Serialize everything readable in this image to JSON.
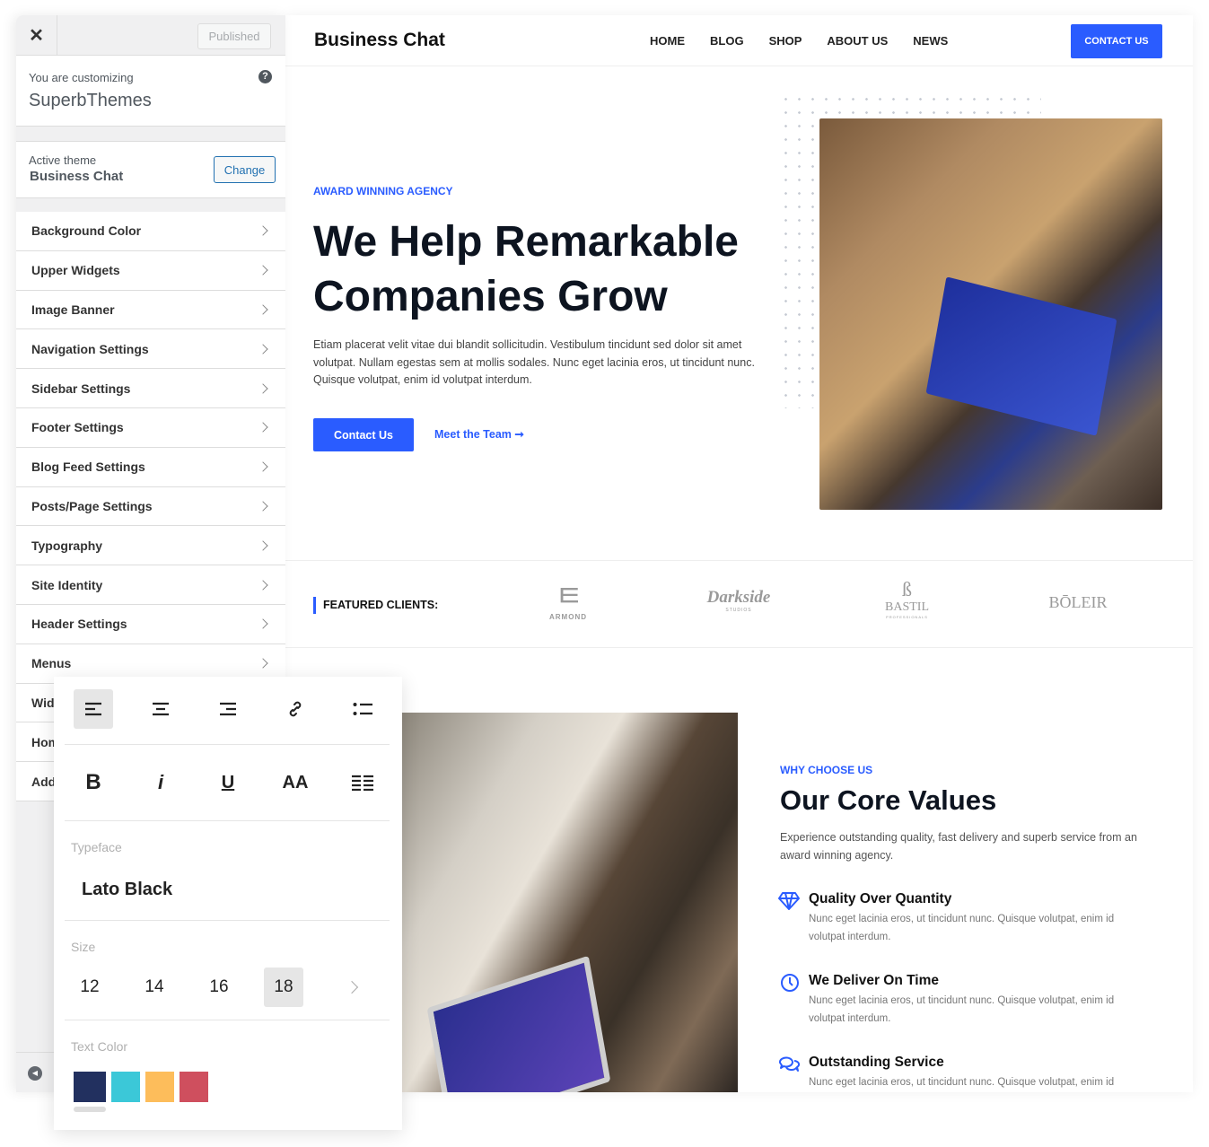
{
  "customizer": {
    "published_label": "Published",
    "customizing_label": "You are customizing",
    "site_name": "SuperbThemes",
    "active_theme_label": "Active theme",
    "active_theme_name": "Business Chat",
    "change_label": "Change",
    "menu": [
      "Background Color",
      "Upper Widgets",
      "Image Banner",
      "Navigation Settings",
      "Sidebar Settings",
      "Footer Settings",
      "Blog Feed Settings",
      "Posts/Page Settings",
      "Typography",
      "Site Identity",
      "Header Settings",
      "Menus",
      "Widgets",
      "Homepage Settings",
      "Additional CSS"
    ]
  },
  "popup": {
    "typeface_label": "Typeface",
    "typeface_value": "Lato Black",
    "size_label": "Size",
    "sizes": [
      "12",
      "14",
      "16",
      "18"
    ],
    "selected_size": "18",
    "text_color_label": "Text Color",
    "colors": [
      "#22305f",
      "#3bc8d8",
      "#fdbd5b",
      "#cf4f5e"
    ],
    "selected_color": "#22305f",
    "format_buttons": {
      "bold": "B",
      "italic": "i",
      "underline": "U",
      "case": "AA"
    }
  },
  "site": {
    "brand": "Business Chat",
    "nav": [
      "HOME",
      "BLOG",
      "SHOP",
      "ABOUT US",
      "NEWS"
    ],
    "cta": "CONTACT US",
    "accent": "#2a5cff",
    "hero": {
      "eyebrow": "AWARD WINNING AGENCY",
      "title": "We Help Remarkable Companies Grow",
      "body": "Etiam placerat velit vitae dui blandit sollicitudin. Vestibulum tincidunt sed dolor sit amet volutpat. Nullam egestas sem at mollis sodales. Nunc eget lacinia eros, ut tincidunt nunc. Quisque volutpat, enim id volutpat interdum.",
      "primary_button": "Contact Us",
      "secondary_link": "Meet the Team"
    },
    "clients": {
      "label": "FEATURED CLIENTS:",
      "logos": [
        "ARMOND",
        "Darkside",
        "BASTIL",
        "BŌLEIR"
      ],
      "logo_subtitles": [
        "STUDIOS",
        "PROFESSIONALS"
      ]
    },
    "values": {
      "eyebrow": "WHY CHOOSE US",
      "title": "Our Core Values",
      "intro": "Experience outstanding quality, fast delivery and superb service from an award winning agency.",
      "items": [
        {
          "icon": "diamond-icon",
          "title": "Quality Over Quantity",
          "text": "Nunc eget lacinia eros, ut tincidunt nunc. Quisque volutpat, enim id volutpat interdum."
        },
        {
          "icon": "clock-icon",
          "title": "We Deliver On Time",
          "text": "Nunc eget lacinia eros, ut tincidunt nunc. Quisque volutpat, enim id volutpat interdum."
        },
        {
          "icon": "chat-bubbles-icon",
          "title": "Outstanding Service",
          "text": "Nunc eget lacinia eros, ut tincidunt nunc. Quisque volutpat, enim id"
        }
      ]
    }
  }
}
